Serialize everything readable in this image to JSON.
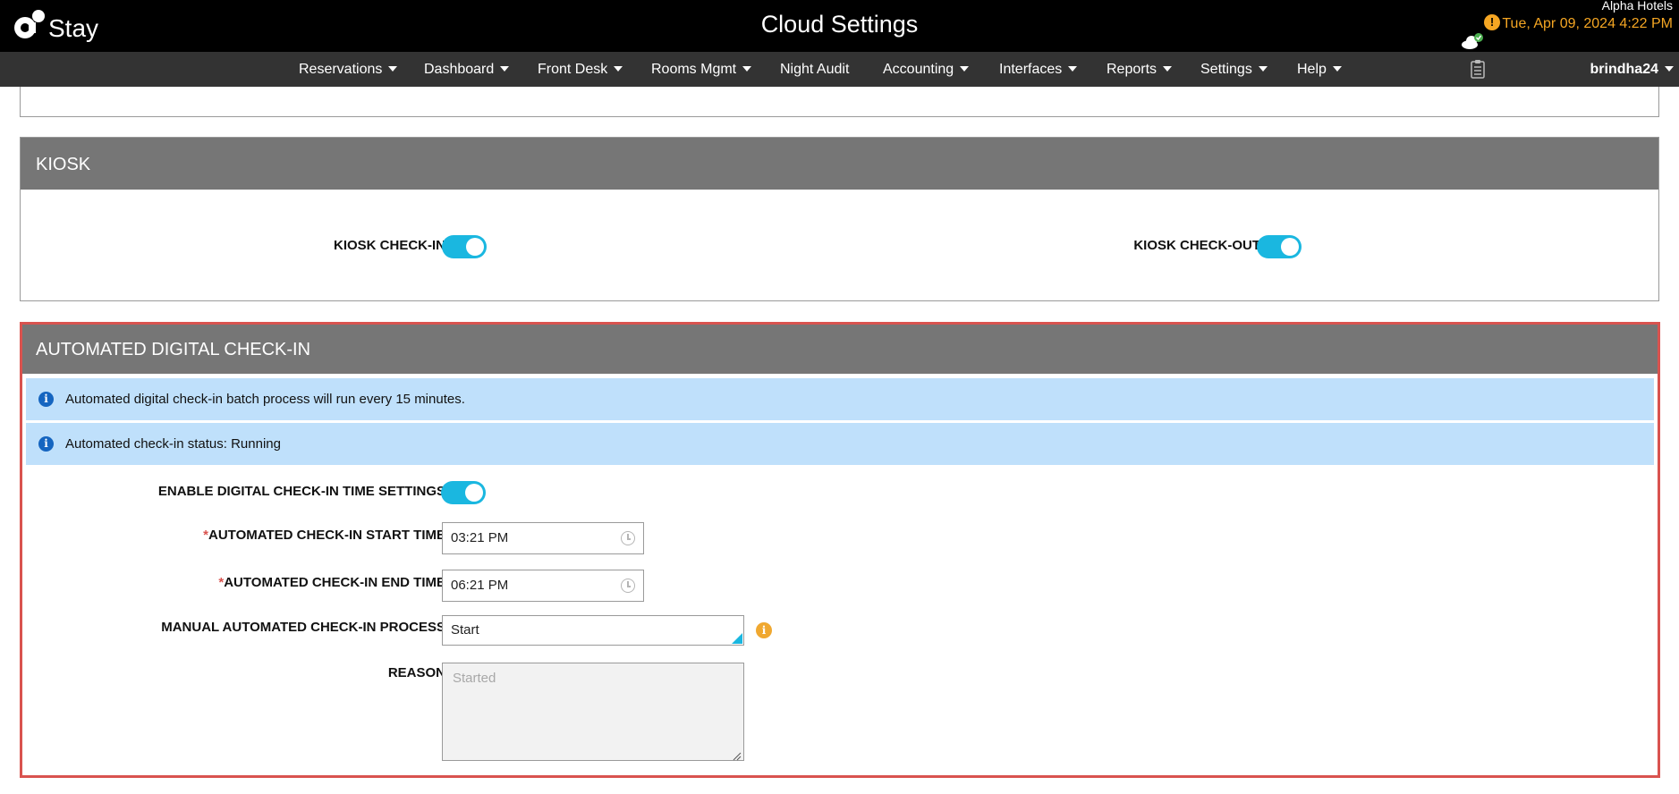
{
  "header": {
    "logo_text": "Stay",
    "title": "Cloud Settings",
    "hotel_name": "Alpha Hotels",
    "datetime": "Tue, Apr 09, 2024 4:22 PM",
    "alert_glyph": "!"
  },
  "nav": {
    "items": [
      {
        "label": "Reservations"
      },
      {
        "label": "Dashboard"
      },
      {
        "label": "Front Desk"
      },
      {
        "label": "Rooms Mgmt"
      },
      {
        "label": "Night Audit"
      },
      {
        "label": "Accounting"
      },
      {
        "label": "Interfaces"
      },
      {
        "label": "Reports"
      },
      {
        "label": "Settings"
      },
      {
        "label": "Help"
      }
    ],
    "user": "brindha24"
  },
  "kiosk": {
    "title": "KIOSK",
    "checkin_label": "KIOSK CHECK-IN",
    "checkin_enabled": true,
    "checkout_label": "KIOSK CHECK-OUT",
    "checkout_enabled": true
  },
  "adc": {
    "title": "AUTOMATED DIGITAL CHECK-IN",
    "info_batch": "Automated digital check-in batch process will run every 15 minutes.",
    "info_status": "Automated check-in status: Running",
    "info_glyph": "i",
    "enable_label": "ENABLE DIGITAL CHECK-IN TIME SETTINGS",
    "enable_on": true,
    "required_mark": "*",
    "start_label": "AUTOMATED CHECK-IN START TIME",
    "start_value": "03:21 PM",
    "end_label": "AUTOMATED CHECK-IN END TIME",
    "end_value": "06:21 PM",
    "manual_label": "MANUAL AUTOMATED CHECK-IN PROCESS",
    "manual_value": "Start",
    "reason_label": "REASON",
    "reason_placeholder": "Started"
  },
  "colors": {
    "accent": "#1ab7e0",
    "highlight_border": "#d9534f",
    "section_header": "#767676",
    "info_bar": "#bfe0fb",
    "datetime": "#f5a623"
  }
}
